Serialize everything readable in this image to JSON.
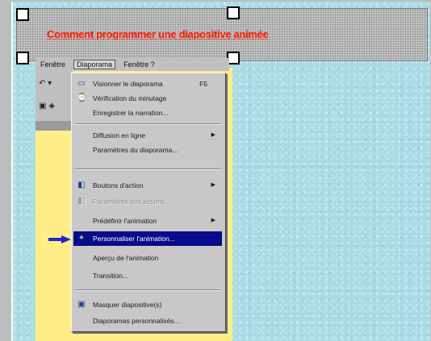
{
  "title": {
    "text": "Comment programmer une diapositive animée"
  },
  "menubar": {
    "items": [
      "Fenêtre",
      "Diaporama",
      "Fenêtre ?"
    ],
    "active_index": 1
  },
  "toolbar": {
    "row1": "↶ ▾",
    "row2": "▣ ◈"
  },
  "menu": {
    "items": [
      {
        "label": "Visionner le diaporama",
        "shortcut": "F5",
        "icon": "slideshow-icon",
        "disabled": false
      },
      {
        "label": "Vérification du minutage",
        "icon": "timer-icon",
        "disabled": false
      },
      {
        "label": "Enregistrer la narration...",
        "disabled": false
      },
      {
        "label": "Diffusion en ligne",
        "submenu": true,
        "disabled": false
      },
      {
        "label": "Paramètres du diaporama...",
        "disabled": false
      },
      {
        "label": "Boutons d'action",
        "submenu": true,
        "icon": "action-button-icon",
        "disabled": false
      },
      {
        "label": "Paramètres des actions...",
        "icon": "action-settings-icon",
        "disabled": true
      },
      {
        "label": "Prédéfinir l'animation",
        "submenu": true,
        "disabled": false
      },
      {
        "label": "Personnaliser l'animation...",
        "icon": "animation-icon",
        "disabled": false,
        "highlighted": true
      },
      {
        "label": "Aperçu de l'animation",
        "disabled": false
      },
      {
        "label": "Transition...",
        "disabled": false
      },
      {
        "label": "Masquer diapositive(s)",
        "icon": "hide-slide-icon",
        "disabled": false
      },
      {
        "label": "Diaporamas personnalisés...",
        "disabled": false
      }
    ]
  },
  "colors": {
    "title_text": "#ff1a00",
    "highlight": "#0a0a8c",
    "pointer": "#2222cc",
    "slide_bg": "#a9dbe6",
    "yellow_panel": "#ffee88"
  }
}
